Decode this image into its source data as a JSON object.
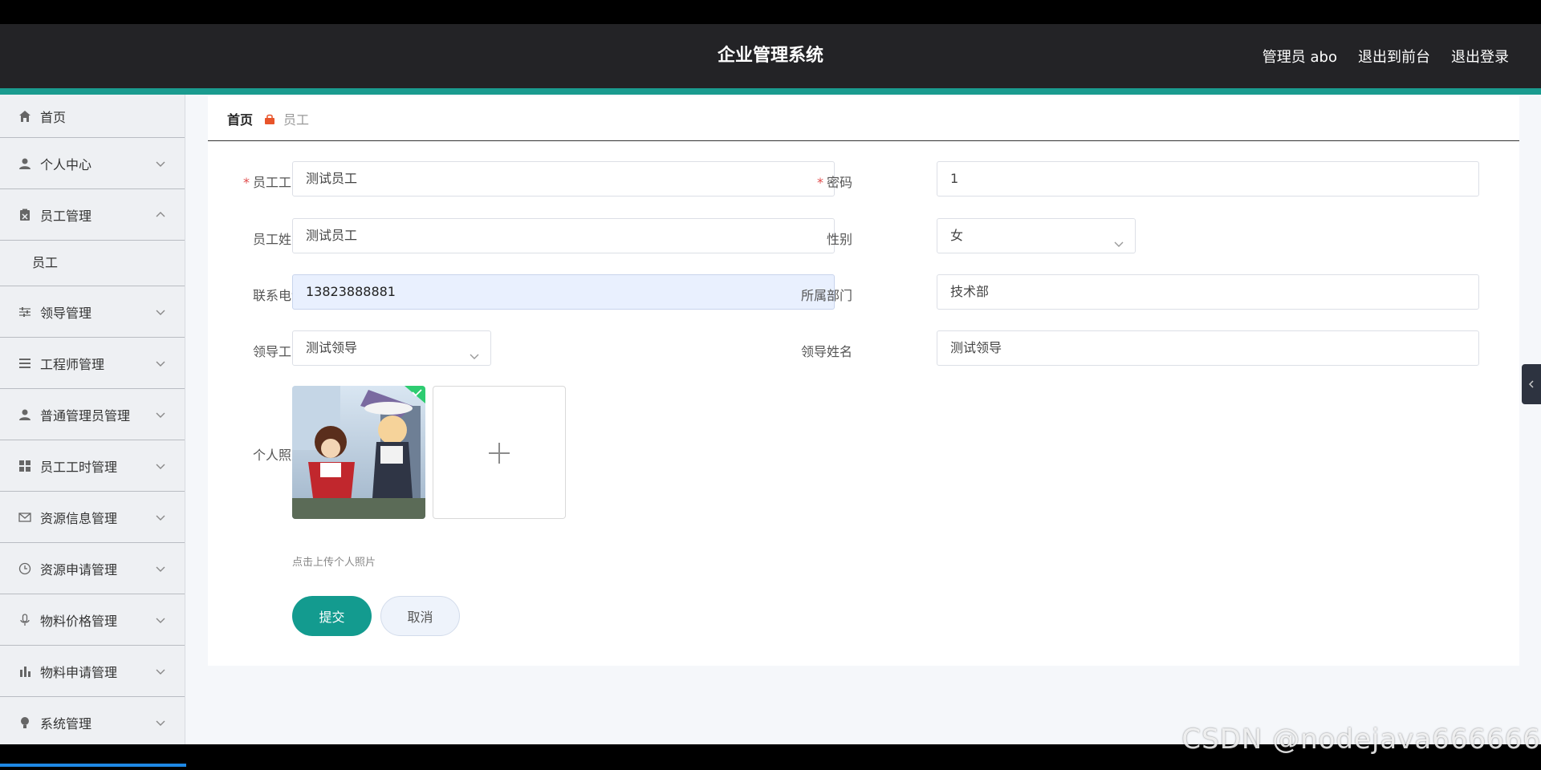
{
  "header": {
    "title": "企业管理系统",
    "user_label": "管理员 abo",
    "front_link": "退出到前台",
    "logout_link": "退出登录"
  },
  "sidebar": {
    "items": [
      {
        "label": "首页",
        "icon": "home-icon"
      },
      {
        "label": "个人中心",
        "icon": "user-icon"
      },
      {
        "label": "员工管理",
        "icon": "clipboard-icon",
        "expanded": true,
        "children": [
          "员工"
        ]
      },
      {
        "label": "领导管理",
        "icon": "sliders-icon"
      },
      {
        "label": "工程师管理",
        "icon": "list-icon"
      },
      {
        "label": "普通管理员管理",
        "icon": "user-icon"
      },
      {
        "label": "员工工时管理",
        "icon": "grid-icon"
      },
      {
        "label": "资源信息管理",
        "icon": "mail-icon"
      },
      {
        "label": "资源申请管理",
        "icon": "clock-icon"
      },
      {
        "label": "物料价格管理",
        "icon": "mic-icon"
      },
      {
        "label": "物料申请管理",
        "icon": "bar-chart-icon"
      },
      {
        "label": "系统管理",
        "icon": "bulb-icon"
      }
    ]
  },
  "breadcrumb": {
    "home": "首页",
    "current": "员工"
  },
  "form": {
    "employee_id": {
      "label": "员工工号",
      "value": "测试员工",
      "required": true
    },
    "password": {
      "label": "密码",
      "value": "1",
      "required": true
    },
    "employee_name": {
      "label": "员工姓名",
      "value": "测试员工"
    },
    "gender": {
      "label": "性别",
      "value": "女"
    },
    "phone": {
      "label": "联系电话",
      "value": "13823888881"
    },
    "department": {
      "label": "所属部门",
      "value": "技术部"
    },
    "leader_id": {
      "label": "领导工号",
      "value": "测试领导"
    },
    "leader_name": {
      "label": "领导姓名",
      "value": "测试领导"
    },
    "photo": {
      "label": "个人照片",
      "hint": "点击上传个人照片"
    },
    "submit_label": "提交",
    "cancel_label": "取消"
  },
  "watermark": "CSDN @nodejava666666",
  "colors": {
    "accent": "#139b8f",
    "header_bg": "#232326",
    "required": "#e04b4b"
  }
}
